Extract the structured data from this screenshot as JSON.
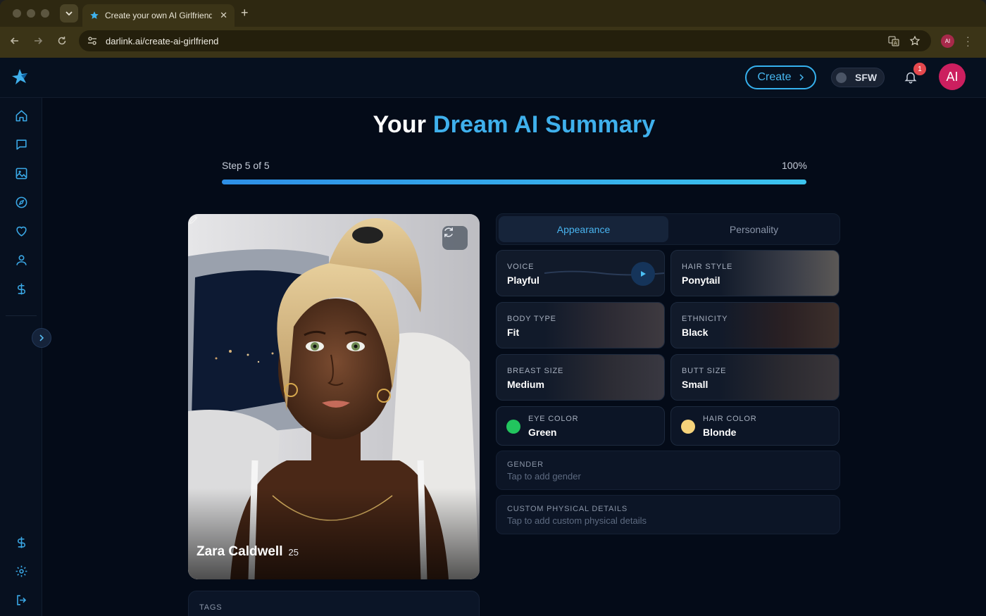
{
  "browser": {
    "tab_title": "Create your own AI Girlfriend",
    "url": "darlink.ai/create-ai-girlfriend",
    "profile_initials": "AI"
  },
  "topbar": {
    "create_label": "Create",
    "sfw_label": "SFW",
    "notification_count": "1",
    "avatar_initials": "AI"
  },
  "page": {
    "title_prefix": "Your",
    "title_accent": "Dream AI Summary",
    "step_label": "Step 5 of 5",
    "progress_label": "100%",
    "progress": 1.0
  },
  "character": {
    "name": "Zara Caldwell",
    "age": "25"
  },
  "tags": {
    "label": "TAGS"
  },
  "tabs": {
    "appearance": "Appearance",
    "personality": "Personality"
  },
  "attributes": {
    "voice": {
      "label": "VOICE",
      "value": "Playful"
    },
    "hair_style": {
      "label": "HAIR STYLE",
      "value": "Ponytail"
    },
    "body_type": {
      "label": "BODY TYPE",
      "value": "Fit"
    },
    "ethnicity": {
      "label": "ETHNICITY",
      "value": "Black"
    },
    "breast_size": {
      "label": "BREAST SIZE",
      "value": "Medium"
    },
    "butt_size": {
      "label": "BUTT SIZE",
      "value": "Small"
    },
    "eye_color": {
      "label": "EYE COLOR",
      "value": "Green",
      "swatch": "#22c55e"
    },
    "hair_color": {
      "label": "HAIR COLOR",
      "value": "Blonde",
      "swatch": "#f5d27a"
    }
  },
  "gender": {
    "label": "GENDER",
    "placeholder": "Tap to add gender"
  },
  "custom_physical": {
    "label": "CUSTOM PHYSICAL DETAILS",
    "placeholder": "Tap to add custom physical details"
  },
  "colors": {
    "accent": "#3fb0ec",
    "background": "#040b18",
    "badge": "#e5484d",
    "avatar": "#cc1f5f"
  }
}
